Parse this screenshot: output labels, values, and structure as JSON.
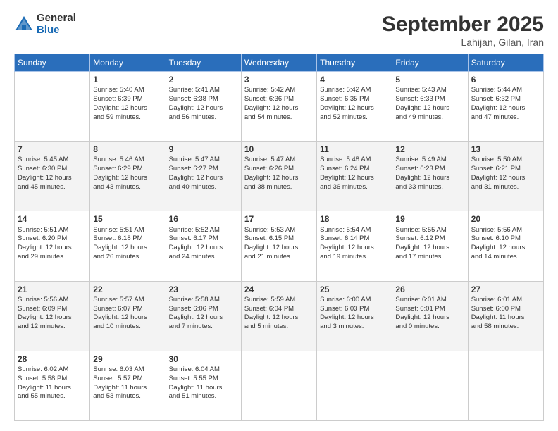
{
  "logo": {
    "general": "General",
    "blue": "Blue"
  },
  "title": "September 2025",
  "location": "Lahijan, Gilan, Iran",
  "days_header": [
    "Sunday",
    "Monday",
    "Tuesday",
    "Wednesday",
    "Thursday",
    "Friday",
    "Saturday"
  ],
  "weeks": [
    [
      {
        "day": "",
        "info": ""
      },
      {
        "day": "1",
        "info": "Sunrise: 5:40 AM\nSunset: 6:39 PM\nDaylight: 12 hours\nand 59 minutes."
      },
      {
        "day": "2",
        "info": "Sunrise: 5:41 AM\nSunset: 6:38 PM\nDaylight: 12 hours\nand 56 minutes."
      },
      {
        "day": "3",
        "info": "Sunrise: 5:42 AM\nSunset: 6:36 PM\nDaylight: 12 hours\nand 54 minutes."
      },
      {
        "day": "4",
        "info": "Sunrise: 5:42 AM\nSunset: 6:35 PM\nDaylight: 12 hours\nand 52 minutes."
      },
      {
        "day": "5",
        "info": "Sunrise: 5:43 AM\nSunset: 6:33 PM\nDaylight: 12 hours\nand 49 minutes."
      },
      {
        "day": "6",
        "info": "Sunrise: 5:44 AM\nSunset: 6:32 PM\nDaylight: 12 hours\nand 47 minutes."
      }
    ],
    [
      {
        "day": "7",
        "info": "Sunrise: 5:45 AM\nSunset: 6:30 PM\nDaylight: 12 hours\nand 45 minutes."
      },
      {
        "day": "8",
        "info": "Sunrise: 5:46 AM\nSunset: 6:29 PM\nDaylight: 12 hours\nand 43 minutes."
      },
      {
        "day": "9",
        "info": "Sunrise: 5:47 AM\nSunset: 6:27 PM\nDaylight: 12 hours\nand 40 minutes."
      },
      {
        "day": "10",
        "info": "Sunrise: 5:47 AM\nSunset: 6:26 PM\nDaylight: 12 hours\nand 38 minutes."
      },
      {
        "day": "11",
        "info": "Sunrise: 5:48 AM\nSunset: 6:24 PM\nDaylight: 12 hours\nand 36 minutes."
      },
      {
        "day": "12",
        "info": "Sunrise: 5:49 AM\nSunset: 6:23 PM\nDaylight: 12 hours\nand 33 minutes."
      },
      {
        "day": "13",
        "info": "Sunrise: 5:50 AM\nSunset: 6:21 PM\nDaylight: 12 hours\nand 31 minutes."
      }
    ],
    [
      {
        "day": "14",
        "info": "Sunrise: 5:51 AM\nSunset: 6:20 PM\nDaylight: 12 hours\nand 29 minutes."
      },
      {
        "day": "15",
        "info": "Sunrise: 5:51 AM\nSunset: 6:18 PM\nDaylight: 12 hours\nand 26 minutes."
      },
      {
        "day": "16",
        "info": "Sunrise: 5:52 AM\nSunset: 6:17 PM\nDaylight: 12 hours\nand 24 minutes."
      },
      {
        "day": "17",
        "info": "Sunrise: 5:53 AM\nSunset: 6:15 PM\nDaylight: 12 hours\nand 21 minutes."
      },
      {
        "day": "18",
        "info": "Sunrise: 5:54 AM\nSunset: 6:14 PM\nDaylight: 12 hours\nand 19 minutes."
      },
      {
        "day": "19",
        "info": "Sunrise: 5:55 AM\nSunset: 6:12 PM\nDaylight: 12 hours\nand 17 minutes."
      },
      {
        "day": "20",
        "info": "Sunrise: 5:56 AM\nSunset: 6:10 PM\nDaylight: 12 hours\nand 14 minutes."
      }
    ],
    [
      {
        "day": "21",
        "info": "Sunrise: 5:56 AM\nSunset: 6:09 PM\nDaylight: 12 hours\nand 12 minutes."
      },
      {
        "day": "22",
        "info": "Sunrise: 5:57 AM\nSunset: 6:07 PM\nDaylight: 12 hours\nand 10 minutes."
      },
      {
        "day": "23",
        "info": "Sunrise: 5:58 AM\nSunset: 6:06 PM\nDaylight: 12 hours\nand 7 minutes."
      },
      {
        "day": "24",
        "info": "Sunrise: 5:59 AM\nSunset: 6:04 PM\nDaylight: 12 hours\nand 5 minutes."
      },
      {
        "day": "25",
        "info": "Sunrise: 6:00 AM\nSunset: 6:03 PM\nDaylight: 12 hours\nand 3 minutes."
      },
      {
        "day": "26",
        "info": "Sunrise: 6:01 AM\nSunset: 6:01 PM\nDaylight: 12 hours\nand 0 minutes."
      },
      {
        "day": "27",
        "info": "Sunrise: 6:01 AM\nSunset: 6:00 PM\nDaylight: 11 hours\nand 58 minutes."
      }
    ],
    [
      {
        "day": "28",
        "info": "Sunrise: 6:02 AM\nSunset: 5:58 PM\nDaylight: 11 hours\nand 55 minutes."
      },
      {
        "day": "29",
        "info": "Sunrise: 6:03 AM\nSunset: 5:57 PM\nDaylight: 11 hours\nand 53 minutes."
      },
      {
        "day": "30",
        "info": "Sunrise: 6:04 AM\nSunset: 5:55 PM\nDaylight: 11 hours\nand 51 minutes."
      },
      {
        "day": "",
        "info": ""
      },
      {
        "day": "",
        "info": ""
      },
      {
        "day": "",
        "info": ""
      },
      {
        "day": "",
        "info": ""
      }
    ]
  ]
}
